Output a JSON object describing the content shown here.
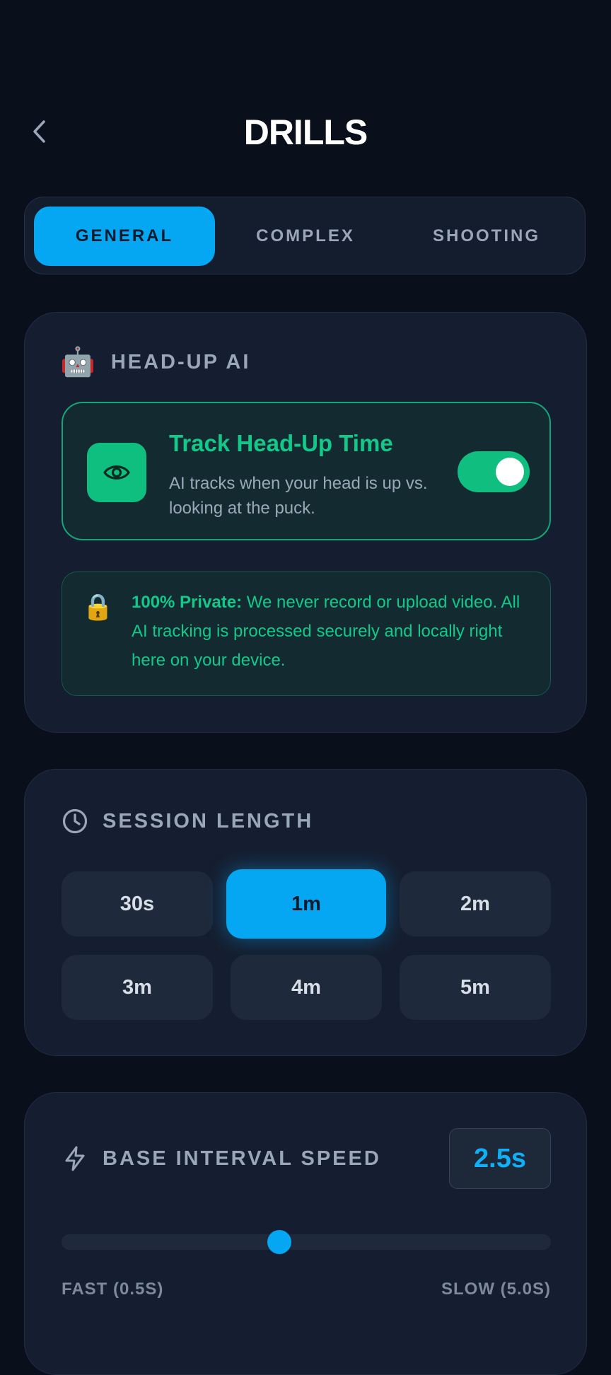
{
  "header": {
    "title": "DRILLS"
  },
  "tabs": [
    {
      "label": "GENERAL",
      "active": true
    },
    {
      "label": "COMPLEX",
      "active": false
    },
    {
      "label": "SHOOTING",
      "active": false
    }
  ],
  "head_up": {
    "section_icon": "robot-icon",
    "section_title": "HEAD-UP AI",
    "track": {
      "icon": "eye-icon",
      "title": "Track Head-Up Time",
      "description": "AI tracks when your head is up vs. looking at the puck.",
      "toggle_on": true
    },
    "privacy": {
      "icon": "lock-icon",
      "bold": "100% Private:",
      "text": " We never record or upload video. All AI tracking is processed securely and locally right here on your device."
    }
  },
  "session": {
    "section_icon": "clock-icon",
    "section_title": "SESSION LENGTH",
    "options": [
      "30s",
      "1m",
      "2m",
      "3m",
      "4m",
      "5m"
    ],
    "selected": "1m"
  },
  "interval": {
    "section_icon": "lightning-icon",
    "section_title": "BASE INTERVAL SPEED",
    "value_label": "2.5s",
    "value": 2.5,
    "min": 0.5,
    "max": 5.0,
    "min_label": "FAST (0.5S)",
    "max_label": "SLOW (5.0S)"
  },
  "colors": {
    "background": "#0a101b",
    "card": "#151e30",
    "accent_blue": "#05a7f2",
    "accent_green": "#10be7f",
    "muted_text": "#9aa6ba"
  }
}
